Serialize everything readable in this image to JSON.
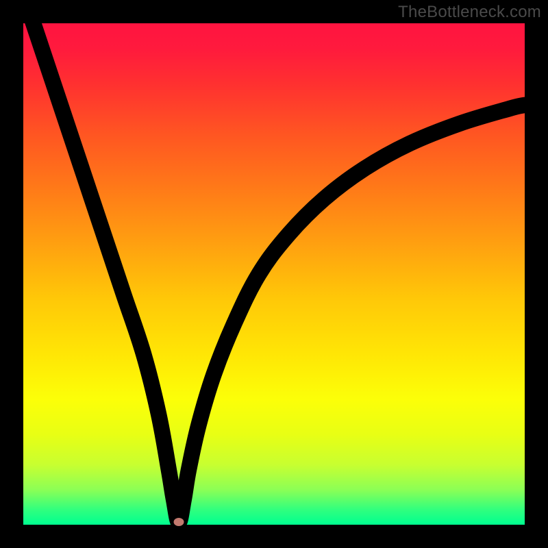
{
  "watermark": "TheBottleneck.com",
  "colors": {
    "marker": "#c27a6f",
    "curve_stroke": "#000000",
    "background": "#000000"
  },
  "chart_data": {
    "type": "line",
    "title": "",
    "xlabel": "",
    "ylabel": "",
    "xlim": [
      0,
      100
    ],
    "ylim": [
      0,
      100
    ],
    "grid": false,
    "legend": false,
    "minimum_point": {
      "x": 31,
      "y": 99.5
    },
    "series": [
      {
        "name": "bottleneck-curve",
        "x": [
          0,
          4,
          8,
          12,
          16,
          20,
          24,
          27,
          29,
          30,
          31,
          32,
          33,
          35,
          38,
          42,
          47,
          53,
          60,
          68,
          77,
          87,
          97,
          100
        ],
        "values": [
          -6,
          6,
          18,
          30,
          42,
          54,
          66,
          78,
          89,
          95,
          99.5,
          95,
          89,
          80,
          70,
          60,
          50,
          42,
          35,
          29,
          24,
          20,
          17,
          16.3
        ]
      }
    ],
    "note": "x/y values estimated from pixels; y = 0 at top of plot area, y = 100 at bottom of plot area"
  }
}
